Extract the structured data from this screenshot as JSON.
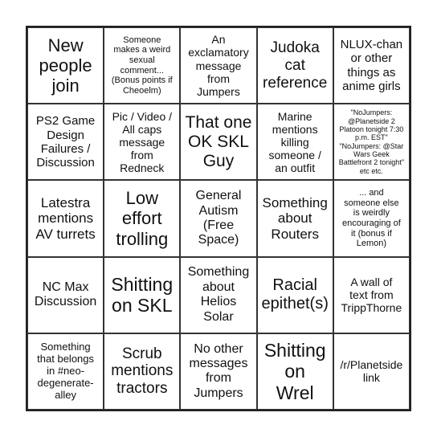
{
  "cells": [
    "New\npeople\njoin",
    "Someone\nmakes a weird\nsexual\ncomment...\n(Bonus points if\nCheoelm)",
    "An\nexclamatory\nmessage\nfrom\nJumpers",
    "Judoka\ncat\nreference",
    "NLUX-chan\nor other\nthings as\nanime girls",
    "PS2 Game\nDesign\nFailures /\nDiscussion",
    "Pic / Video /\nAll caps\nmessage\nfrom\nRedneck",
    "That one\nOK SKL\nGuy",
    "Marine\nmentions\nkilling\nsomeone /\nan outfit",
    "\"NoJumpers:\n@Planetside 2\nPlatoon tonight 7:30\np.m. EST\"\n\"NoJumpers: @Star\nWars Geek\nBattlefront 2 tonight\"\netc etc.",
    "Latestra\nmentions\nAV turrets",
    "Low\neffort\ntrolling",
    "General\nAutism\n(Free\nSpace)",
    "Something\nabout\nRouters",
    "... and\nsomeone else\nis weirdly\nencouraging of\nit (bonus if\nLemon)",
    "NC Max\nDiscussion",
    "Shitting\non SKL",
    "Something\nabout\nHelios\nSolar",
    "Racial\nepithet(s)",
    "A wall of\ntext from\nTrippThorne",
    "Something\nthat belongs\nin #neo-\ndegenerate-\nalley",
    "Scrub\nmentions\ntractors",
    "No other\nmessages\nfrom\nJumpers",
    "Shitting\non\nWrel",
    "/r/Planetside\nlink"
  ]
}
